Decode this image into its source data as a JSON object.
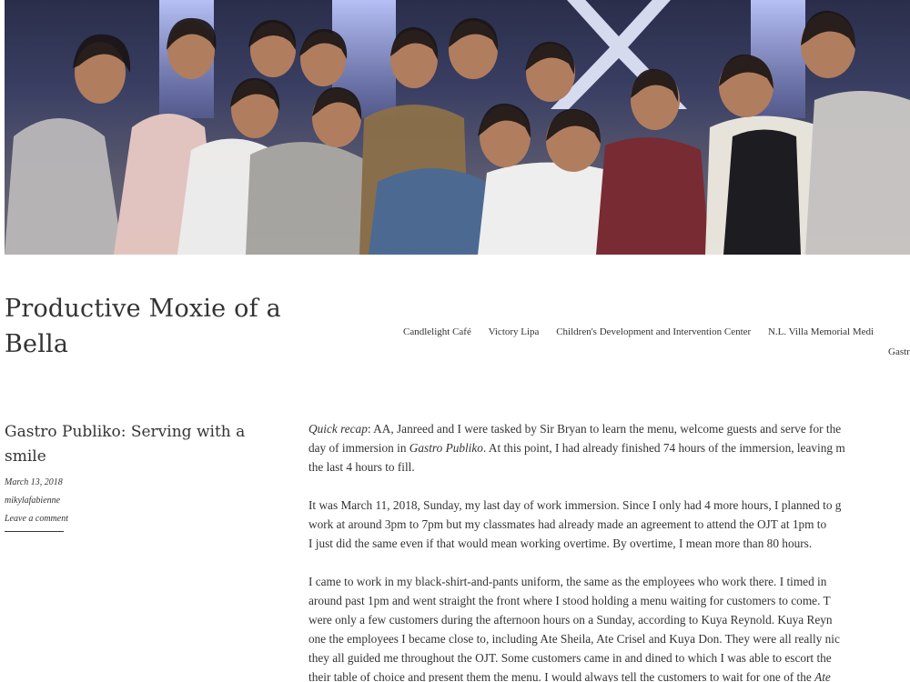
{
  "header": {
    "photo_alt": "Group photo"
  },
  "site": {
    "title_line1": "Productive Moxie of a",
    "title_line2": "Bella"
  },
  "nav": {
    "items": [
      {
        "label": "Candlelight Café"
      },
      {
        "label": "Victory Lipa"
      },
      {
        "label": "Children's Development and Intervention Center"
      },
      {
        "label": "N.L. Villa Memorial Medi"
      }
    ],
    "overflow_item": "Gastr"
  },
  "post": {
    "title_line1": "Gastro Publiko: Serving with a",
    "title_line2": "smile",
    "date": "March 13, 2018",
    "author": "mikylafabienne",
    "comment_link": "Leave a comment",
    "paragraphs": [
      {
        "lines": [
          {
            "prefix_italic": "Quick recap",
            "text": ": AA, Janreed and I were tasked by Sir Bryan to learn the menu, welcome guests and serve for the"
          },
          {
            "text_before": "day of immersion in ",
            "italic": "Gastro Publiko",
            "text_after": ". At this point, I had already finished 74 hours of the immersion, leaving m"
          },
          {
            "text": "the last 4 hours to fill."
          }
        ]
      },
      {
        "lines": [
          {
            "text": "It was March 11, 2018, Sunday, my last day of work immersion. Since I only had 4 more hours, I planned to g"
          },
          {
            "text": "work at around 3pm to 7pm but my classmates had already made an agreement to attend the OJT at 1pm to"
          },
          {
            "text": "I just did the same even if that would mean working overtime. By overtime, I mean more than 80 hours."
          }
        ]
      },
      {
        "lines": [
          {
            "text": "I came to work in my black-shirt-and-pants uniform, the same as the employees who work there. I timed in"
          },
          {
            "text": "around past 1pm and went straight the front where I stood holding a menu waiting for customers to come. T"
          },
          {
            "text": "were only a few customers during the afternoon hours on a Sunday, according to Kuya Reynold. Kuya Reyn"
          },
          {
            "text": "one the employees I became close to, including Ate Sheila, Ate Crisel and Kuya Don. They were all really nic"
          },
          {
            "text": "they all guided me throughout the OJT. Some customers came in and dined to which I was able to escort the"
          },
          {
            "text_before": "their table of choice and present them the menu. I would always tell the customers to wait for one of the ",
            "italic": "Ate"
          }
        ]
      }
    ]
  }
}
